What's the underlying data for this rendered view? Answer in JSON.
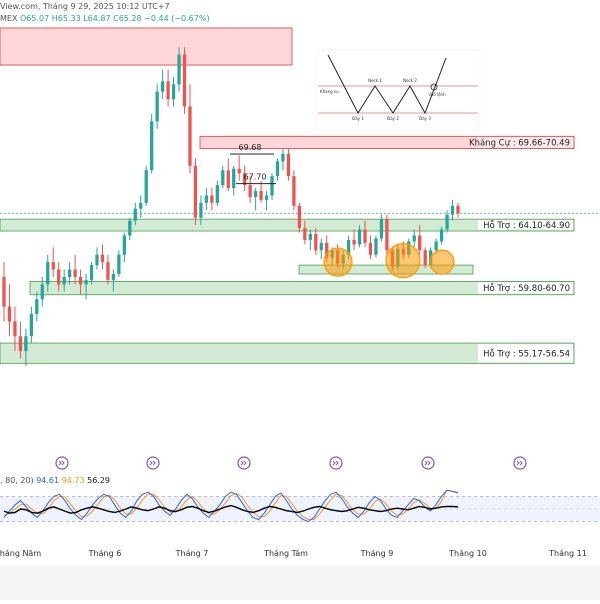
{
  "header": {
    "line1_prefix": "View.com,",
    "line1_date": "Tháng 9 29, 2025 10:12 UTC+7",
    "line2_symbol": "MEX",
    "ohlc_o": "O65.07",
    "ohlc_h": "H65.33",
    "ohlc_l": "L64.87",
    "ohlc_c": "C65.28",
    "ohlc_change": "−0.44 (−0.67%)"
  },
  "zones": {
    "resistance_label": "Kháng Cự : 69.66-70.49",
    "support1_label": "Hỗ Trợ : 64.10-64.90",
    "support2_label": "Hỗ Trợ : 59.80-60.70",
    "support3_label": "Hỗ Trợ : 55.17-56.54"
  },
  "annotations": {
    "peak1": "69.68",
    "peak2": "67.70"
  },
  "inset_diagram": {
    "top_label": "Neck 1",
    "mid_label": "Neck 2",
    "left_label": "Khang cu",
    "low1": "Đáy 1",
    "low2": "Đáy 2",
    "low3": "Đáy 3",
    "right_label": "Vào lệnh"
  },
  "stochastic": {
    "params": ", 80, 20)",
    "k_value": "94.61",
    "d_value": "94.73",
    "extra_value": "56.29"
  },
  "x_axis": {
    "labels": [
      "Tháng Năm",
      "Tháng 6",
      "Tháng 7",
      "Tháng Tám",
      "Tháng 9",
      "Tháng 10",
      "Tháng 11"
    ]
  },
  "colors": {
    "up": "#26a69a",
    "down": "#ef5350",
    "support_fill": "#c8e6c9",
    "support_stroke": "#43a047",
    "resistance_fill": "#ffcdd2",
    "resistance_stroke": "#e53935",
    "circle": "#ff9800",
    "event_icon": "#7e57c2",
    "stoch_k": "#2962ff",
    "stoch_d": "#ff9800",
    "stoch_extra": "#000000"
  },
  "chart_data": {
    "type": "candlestick",
    "y_range": [
      50,
      78
    ],
    "candles": [
      [
        61,
        62,
        58,
        59
      ],
      [
        59,
        60.5,
        57,
        58
      ],
      [
        58,
        59,
        56,
        57
      ],
      [
        57,
        58,
        55.5,
        56
      ],
      [
        56,
        57.5,
        55,
        57
      ],
      [
        57,
        59,
        56.5,
        58.5
      ],
      [
        58.5,
        60,
        58,
        59.5
      ],
      [
        59.5,
        61,
        59,
        60.5
      ],
      [
        60.5,
        62.5,
        60,
        62
      ],
      [
        62,
        63,
        61,
        61.5
      ],
      [
        61.5,
        62,
        60,
        60.5
      ],
      [
        60.5,
        61.5,
        60,
        61
      ],
      [
        61,
        62,
        60.5,
        61.5
      ],
      [
        61.5,
        62.5,
        60.5,
        61
      ],
      [
        61,
        61.5,
        59.8,
        60.5
      ],
      [
        60.5,
        61.2,
        59.5,
        60.8
      ],
      [
        60.8,
        62,
        60.5,
        61.8
      ],
      [
        61.8,
        63,
        61.5,
        62.5
      ],
      [
        62.5,
        63.2,
        61.5,
        62
      ],
      [
        62,
        62.5,
        60.5,
        60.8
      ],
      [
        60.8,
        61.5,
        60,
        61.2
      ],
      [
        61.2,
        62.8,
        61,
        62.5
      ],
      [
        62.5,
        64,
        62,
        63.8
      ],
      [
        63.8,
        65,
        63.5,
        64.8
      ],
      [
        64.8,
        66,
        64.5,
        65.6
      ],
      [
        65.6,
        66.5,
        65,
        66
      ],
      [
        66,
        68.5,
        65.8,
        68.2
      ],
      [
        68.2,
        72,
        68,
        71.5
      ],
      [
        71.5,
        74,
        71,
        73.5
      ],
      [
        73.5,
        75,
        73,
        74.2
      ],
      [
        74.2,
        75,
        72.5,
        73
      ],
      [
        73,
        74.5,
        72.5,
        74
      ],
      [
        74,
        76.5,
        73.5,
        76
      ],
      [
        76,
        76.5,
        72,
        72.5
      ],
      [
        72.5,
        74,
        68,
        68.5
      ],
      [
        68.5,
        69,
        64.5,
        65
      ],
      [
        65,
        66.5,
        64.5,
        66
      ],
      [
        66,
        67,
        65.5,
        66.5
      ],
      [
        66.5,
        67,
        65.5,
        66
      ],
      [
        66,
        67.5,
        65.8,
        67.2
      ],
      [
        67.2,
        68.5,
        67,
        68.2
      ],
      [
        68.2,
        69,
        66.8,
        67
      ],
      [
        67,
        68.5,
        66.5,
        68.3
      ],
      [
        68.3,
        69.2,
        67.5,
        68
      ],
      [
        68,
        68.5,
        66.8,
        67.2
      ],
      [
        67.2,
        67.8,
        66,
        66.4
      ],
      [
        66.4,
        67,
        65.5,
        66.8
      ],
      [
        66.8,
        67.5,
        66,
        66.2
      ],
      [
        66.2,
        66.8,
        65.5,
        66.5
      ],
      [
        66.5,
        68,
        66.2,
        67.8
      ],
      [
        67.8,
        69,
        67.5,
        68.8
      ],
      [
        68.8,
        69.7,
        68.2,
        69.3
      ],
      [
        69.3,
        69.7,
        67.5,
        67.8
      ],
      [
        67.8,
        68.2,
        65.5,
        65.8
      ],
      [
        65.8,
        66,
        64,
        64.3
      ],
      [
        64.3,
        64.8,
        63.2,
        63.5
      ],
      [
        63.5,
        64.2,
        62.8,
        63.9
      ],
      [
        63.9,
        64.3,
        62.5,
        62.8
      ],
      [
        62.8,
        63.6,
        62.2,
        63.3
      ],
      [
        63.3,
        63.8,
        62,
        62.3
      ],
      [
        62.3,
        63,
        61.8,
        62.8
      ],
      [
        62.8,
        63.2,
        61.6,
        61.9
      ],
      [
        61.9,
        62.8,
        61.5,
        62.5
      ],
      [
        62.5,
        63.8,
        62.2,
        63.5
      ],
      [
        63.5,
        64.2,
        62.8,
        63.2
      ],
      [
        63.2,
        64.5,
        63,
        64.2
      ],
      [
        64.2,
        64.8,
        63,
        63.3
      ],
      [
        63.3,
        63.8,
        62.2,
        62.5
      ],
      [
        62.5,
        63.8,
        62.3,
        63.6
      ],
      [
        63.6,
        65.2,
        63.4,
        64.9
      ],
      [
        64.9,
        65.2,
        62.5,
        62.8
      ],
      [
        62.8,
        63,
        61.4,
        61.7
      ],
      [
        61.7,
        63.2,
        61.5,
        62.9
      ],
      [
        62.9,
        63.4,
        62.2,
        62.5
      ],
      [
        62.5,
        63.6,
        62.3,
        63.4
      ],
      [
        63.4,
        64.2,
        63,
        63.8
      ],
      [
        63.8,
        64.5,
        62.5,
        62.8
      ],
      [
        62.8,
        63,
        61.6,
        61.8
      ],
      [
        61.8,
        63,
        61.6,
        62.8
      ],
      [
        62.8,
        63.6,
        62.6,
        63.4
      ],
      [
        63.4,
        64.4,
        63.2,
        64.2
      ],
      [
        64.2,
        65.5,
        64,
        65.2
      ],
      [
        65.2,
        66.2,
        64.8,
        65.8
      ],
      [
        65.8,
        66,
        65,
        65.3
      ]
    ],
    "stoch_k": [
      30,
      45,
      60,
      70,
      55,
      40,
      30,
      45,
      65,
      80,
      85,
      70,
      50,
      35,
      25,
      40,
      60,
      75,
      85,
      80,
      60,
      40,
      30,
      45,
      70,
      85,
      90,
      80,
      60,
      45,
      35,
      50,
      70,
      85,
      75,
      55,
      40,
      30,
      45,
      60,
      80,
      90,
      85,
      65,
      45,
      30,
      25,
      40,
      60,
      80,
      88,
      70,
      50,
      35,
      25,
      20,
      30,
      50,
      70,
      85,
      90,
      75,
      55,
      40,
      30,
      45,
      65,
      80,
      70,
      50,
      35,
      30,
      45,
      60,
      75,
      70,
      55,
      45,
      60,
      80,
      94.61,
      92,
      88
    ],
    "stoch_d": [
      35,
      40,
      50,
      60,
      62,
      50,
      40,
      38,
      50,
      70,
      80,
      78,
      62,
      45,
      32,
      33,
      45,
      62,
      78,
      83,
      72,
      52,
      38,
      38,
      52,
      72,
      85,
      85,
      72,
      55,
      42,
      43,
      55,
      72,
      80,
      68,
      50,
      38,
      38,
      48,
      65,
      82,
      87,
      78,
      58,
      42,
      32,
      32,
      45,
      65,
      82,
      80,
      62,
      45,
      32,
      25,
      25,
      38,
      55,
      72,
      85,
      82,
      66,
      48,
      38,
      38,
      50,
      68,
      74,
      62,
      45,
      35,
      38,
      50,
      65,
      72,
      63,
      52,
      52,
      68,
      94.73,
      92,
      90
    ],
    "stoch_extra": [
      45,
      40,
      42,
      50,
      48,
      42,
      40,
      45,
      52,
      55,
      50,
      45,
      40,
      42,
      48,
      52,
      55,
      52,
      48,
      44,
      42,
      45,
      50,
      55,
      52,
      48,
      46,
      50,
      55,
      52,
      46,
      44,
      48,
      54,
      56,
      52,
      46,
      42,
      45,
      50,
      55,
      58,
      54,
      48,
      44,
      42,
      46,
      52,
      56,
      54,
      50,
      46,
      44,
      42,
      45,
      50,
      54,
      56,
      52,
      48,
      46,
      44,
      46,
      50,
      54,
      52,
      48,
      46,
      44,
      46,
      50,
      52,
      50,
      48,
      52,
      56,
      54,
      50,
      52,
      55,
      56.29,
      56,
      55
    ]
  }
}
